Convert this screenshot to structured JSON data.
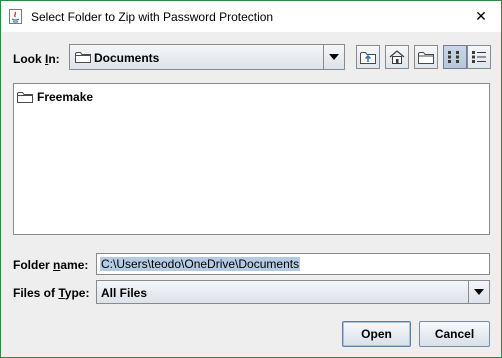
{
  "window": {
    "title": "Select Folder to Zip with Password Protection",
    "close_symbol": "✕",
    "border_color": "#2b8a3e"
  },
  "lookin": {
    "label_pre": "Look ",
    "label_mnemonic": "I",
    "label_post": "n:",
    "value": "Documents",
    "icon": "folder-icon"
  },
  "toolbar": {
    "icons": [
      "up-one-level-icon",
      "home-icon",
      "new-folder-icon",
      "list-view-icon",
      "details-view-icon"
    ],
    "pressed": "list-view-icon"
  },
  "files": [
    {
      "name": "Freemake",
      "icon": "folder-icon"
    }
  ],
  "folder_name": {
    "label_pre": "Folder ",
    "label_mnemonic": "n",
    "label_post": "ame:",
    "value": "C:\\Users\\teodo\\OneDrive\\Documents"
  },
  "files_of_type": {
    "label_pre": "Files of ",
    "label_mnemonic": "T",
    "label_post": "ype:",
    "value": "All Files"
  },
  "buttons": {
    "open": "Open",
    "cancel": "Cancel"
  }
}
